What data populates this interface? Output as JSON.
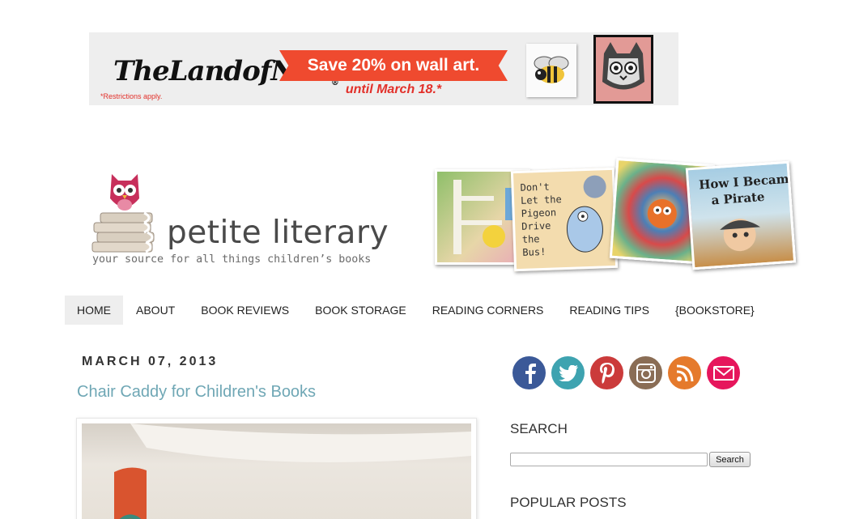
{
  "ad": {
    "brand": "TheLandofNod",
    "headline": "Save 20% on wall art.",
    "until": "until March 18.*",
    "restrictions": "*Restrictions apply."
  },
  "header": {
    "site_title": "petite literary",
    "tagline": "your source for all things children’s books",
    "covers": [
      {
        "text": ""
      },
      {
        "text": "Don't Let the Pigeon Drive the Bus!"
      },
      {
        "text": ""
      },
      {
        "text": "How I Became a Pirate"
      }
    ]
  },
  "nav": {
    "items": [
      "HOME",
      "ABOUT",
      "BOOK REVIEWS",
      "BOOK STORAGE",
      "READING CORNERS",
      "READING TIPS",
      "{BOOKSTORE}"
    ],
    "active_index": 0
  },
  "post": {
    "date": "MARCH 07, 2013",
    "title": "Chair Caddy for Children's Books"
  },
  "sidebar": {
    "social": [
      {
        "name": "facebook-icon",
        "color": "#3b5998"
      },
      {
        "name": "twitter-icon",
        "color": "#3ea3b0"
      },
      {
        "name": "pinterest-icon",
        "color": "#cb3b3b"
      },
      {
        "name": "instagram-icon",
        "color": "#8a6d55"
      },
      {
        "name": "rss-icon",
        "color": "#e57a2c"
      },
      {
        "name": "email-icon",
        "color": "#e6165c"
      }
    ],
    "search_heading": "SEARCH",
    "search_value": "",
    "search_button": "Search",
    "popular_heading": "POPULAR POSTS"
  }
}
